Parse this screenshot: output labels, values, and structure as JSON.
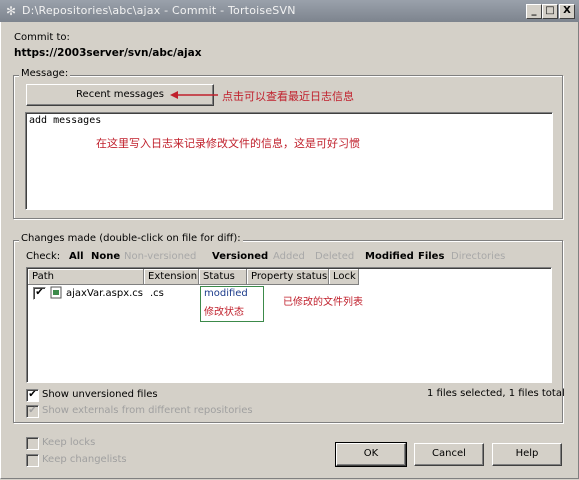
{
  "window": {
    "title": "D:\\Repositories\\abc\\ajax - Commit - TortoiseSVN",
    "app_icon": "tortoise-icon",
    "min_label": "_",
    "max_label": "□",
    "close_label": "X"
  },
  "commit": {
    "label": "Commit to:",
    "url": "https://2003server/svn/abc/ajax"
  },
  "message": {
    "group_label": "Message:",
    "recent_button": "Recent messages",
    "annotation_recent": "点击可以查看最近日志信息",
    "text": "add messages",
    "annotation_text": "在这里写入日志来记录修改文件的信息，这是可好习惯"
  },
  "changes": {
    "group_label": "Changes made (double-click on file for diff):",
    "check_label": "Check:",
    "options": [
      "All",
      "None",
      "Non-versioned",
      "Versioned",
      "Added",
      "Deleted",
      "Modified",
      "Files",
      "Directories"
    ],
    "columns": [
      "Path",
      "Extension",
      "Status",
      "Property status",
      "Lock"
    ],
    "rows": [
      {
        "checked": "✔",
        "path": "ajaxVar.aspx.cs",
        "extension": ".cs",
        "status": "modified"
      }
    ],
    "annotation_status": "修改状态",
    "annotation_list": "已修改的文件列表",
    "show_unversioned": "Show unversioned files",
    "show_externals": "Show externals from different repositories",
    "summary": "1 files selected, 1 files total"
  },
  "bottom": {
    "keep_locks": "Keep locks",
    "keep_changelists": "Keep changelists",
    "ok": "OK",
    "cancel": "Cancel",
    "help": "Help"
  },
  "colors": {
    "annotation": "#c0202c",
    "arrow": "#c0202c",
    "status_box": "#3c8a4a"
  }
}
